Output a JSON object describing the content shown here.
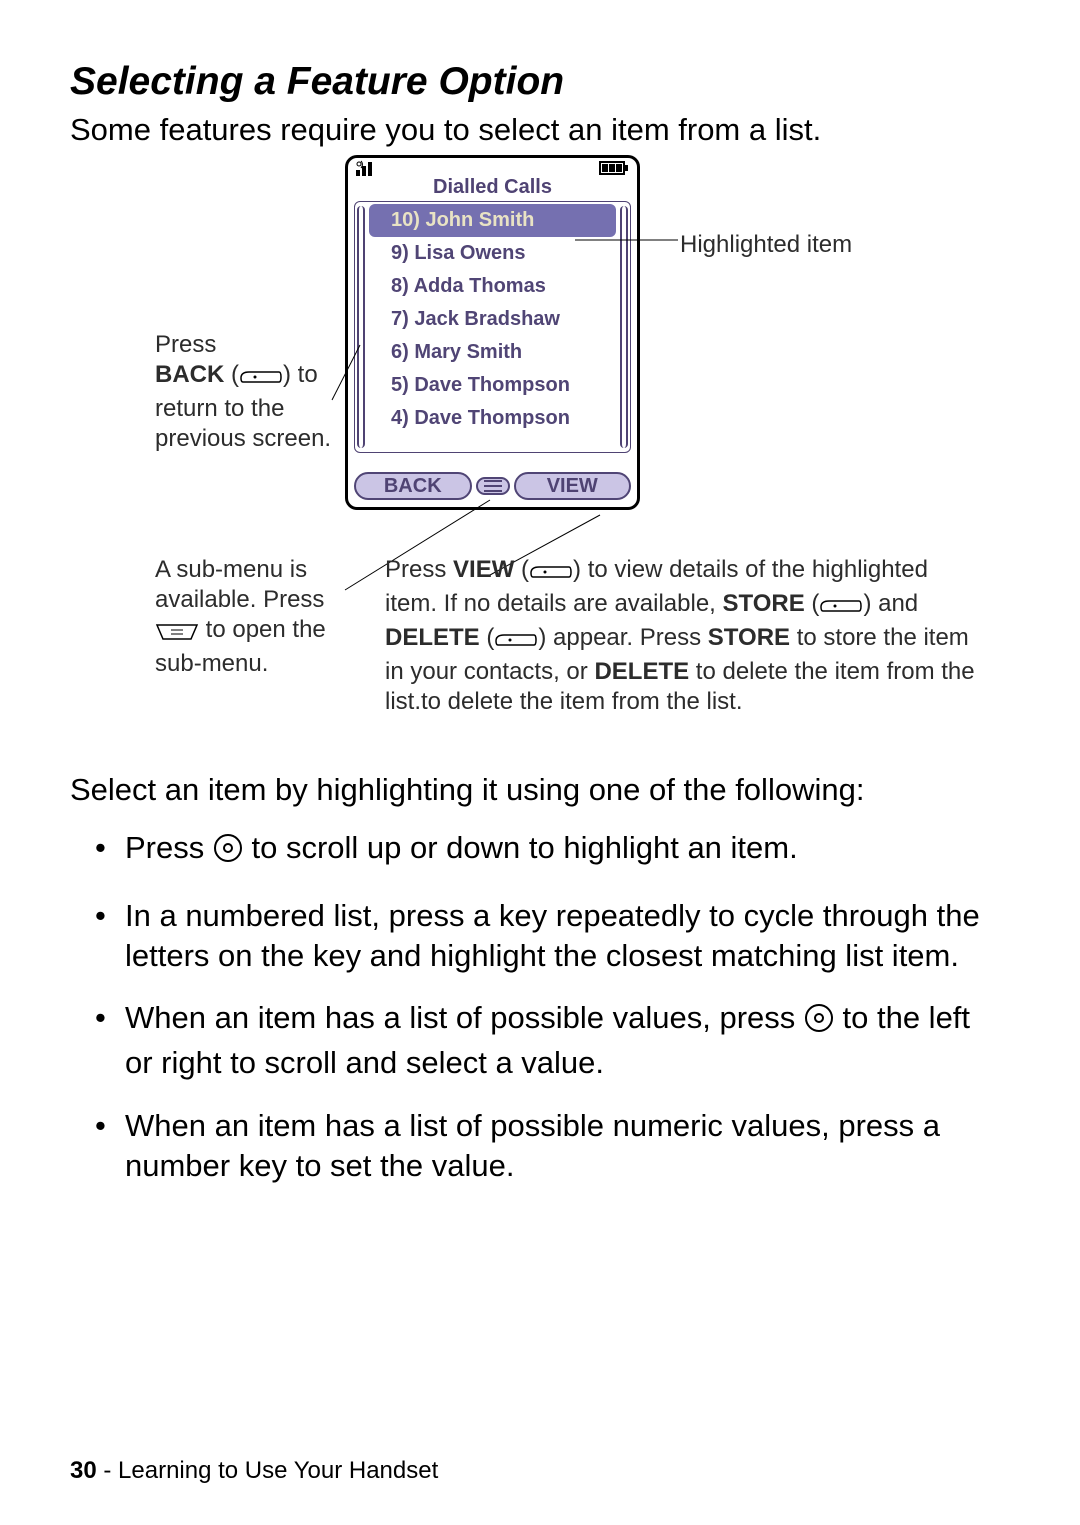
{
  "heading": "Selecting a Feature Option",
  "intro": "Some features require you to select an item from a list.",
  "phone": {
    "title": "Dialled Calls",
    "items": [
      {
        "n": "10)",
        "name": "John Smith",
        "hi": true
      },
      {
        "n": "9)",
        "name": "Lisa Owens"
      },
      {
        "n": "8)",
        "name": "Adda Thomas"
      },
      {
        "n": "7)",
        "name": "Jack Bradshaw"
      },
      {
        "n": "6)",
        "name": "Mary Smith"
      },
      {
        "n": "5)",
        "name": "Dave Thompson"
      },
      {
        "n": "4)",
        "name": "Dave Thompson"
      }
    ],
    "soft_left": "BACK",
    "soft_right": "VIEW"
  },
  "annot": {
    "highlighted": "Highlighted item",
    "back_1": "Press",
    "back_key": "BACK",
    "back_2": "to return to the previous screen.",
    "submenu_1": "A sub-menu is available. Press",
    "submenu_2": "to open the sub-menu.",
    "view_1": "Press ",
    "view_key": "VIEW",
    "view_2": " to view details of the highlighted item. If no details are available, ",
    "store_key": "STORE",
    "and": " and ",
    "delete_key": "DELETE",
    "view_3": " appear. Press ",
    "view_4": " to store the item in your contacts, or ",
    "view_5": " to delete the item from the list.to delete the item from the list."
  },
  "body": {
    "lead": "Select an item by highlighting it using one of the following:",
    "b1a": "Press ",
    "b1b": " to scroll up or down to highlight an item.",
    "b2": "In a numbered list, press a key repeatedly to cycle through the letters on the key and highlight the closest matching list item.",
    "b3a": "When an item has a list of possible values, press ",
    "b3b": " to the left or right to scroll and select a value.",
    "b4": "When an item has a list of possible numeric values, press a number key to set the value."
  },
  "footer": {
    "page": "30",
    "section": "Learning to Use Your Handset"
  }
}
